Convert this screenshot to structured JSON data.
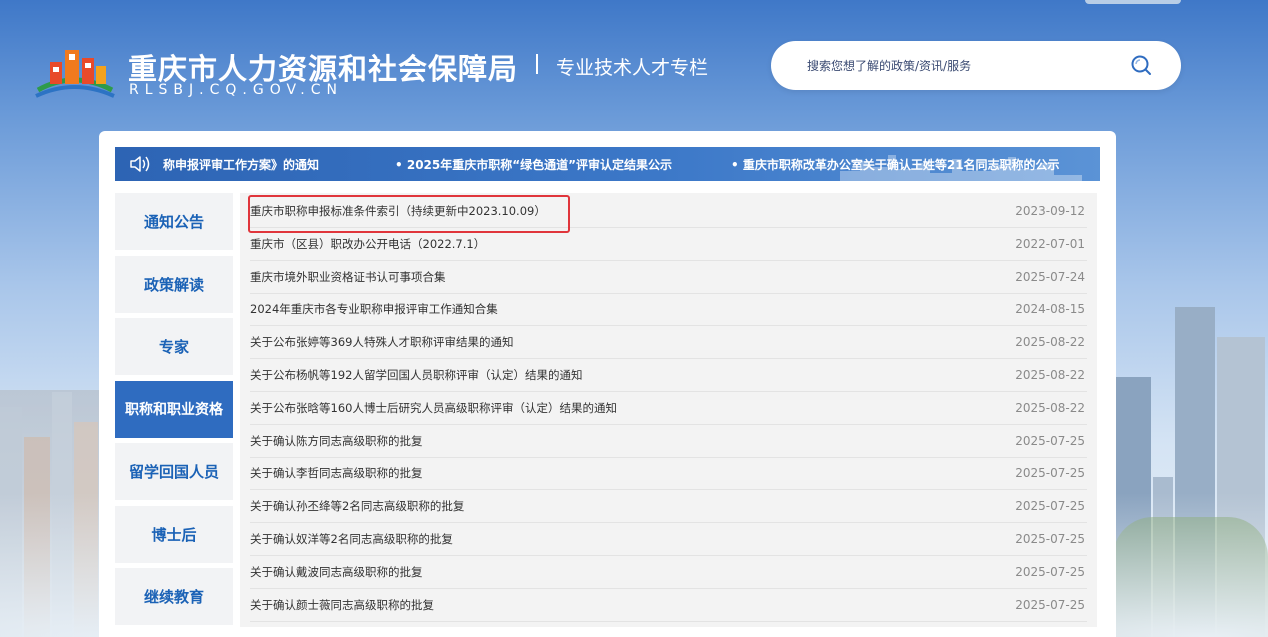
{
  "header": {
    "title": "重庆市人力资源和社会保障局",
    "domain": "RLSBJ.CQ.GOV.CN",
    "separator": "|",
    "column_name": "专业技术人才专栏"
  },
  "search": {
    "placeholder": "搜索您想了解的政策/资讯/服务",
    "icon": "search-icon"
  },
  "ticker": {
    "icon": "speaker-icon",
    "items": [
      "称申报评审工作方案》的通知",
      "• 2025年重庆市职称“绿色通道”评审认定结果公示",
      "• 重庆市职称改革办公室关于确认王姓等21名同志职称的公示"
    ]
  },
  "sidebar": {
    "items": [
      {
        "label": "通知公告"
      },
      {
        "label": "政策解读"
      },
      {
        "label": "专家"
      },
      {
        "label": "职称和职业资格"
      },
      {
        "label": "留学回国人员"
      },
      {
        "label": "博士后"
      },
      {
        "label": "继续教育"
      }
    ],
    "active_index": 3
  },
  "list": {
    "rows": [
      {
        "title": "重庆市职称申报标准条件索引（持续更新中2023.10.09）",
        "date": "2023-09-12"
      },
      {
        "title": "重庆市（区县）职改办公开电话（2022.7.1）",
        "date": "2022-07-01"
      },
      {
        "title": "重庆市境外职业资格证书认可事项合集",
        "date": "2025-07-24"
      },
      {
        "title": "2024年重庆市各专业职称申报评审工作通知合集",
        "date": "2024-08-15"
      },
      {
        "title": "关于公布张婷等369人特殊人才职称评审结果的通知",
        "date": "2025-08-22"
      },
      {
        "title": "关于公布杨帆等192人留学回国人员职称评审（认定）结果的通知",
        "date": "2025-08-22"
      },
      {
        "title": "关于公布张晗等160人博士后研究人员高级职称评审（认定）结果的通知",
        "date": "2025-08-22"
      },
      {
        "title": "关于确认陈方同志高级职称的批复",
        "date": "2025-07-25"
      },
      {
        "title": "关于确认李哲同志高级职称的批复",
        "date": "2025-07-25"
      },
      {
        "title": "关于确认孙丕绛等2名同志高级职称的批复",
        "date": "2025-07-25"
      },
      {
        "title": "关于确认奴洋等2名同志高级职称的批复",
        "date": "2025-07-25"
      },
      {
        "title": "关于确认戴波同志高级职称的批复",
        "date": "2025-07-25"
      },
      {
        "title": "关于确认颜士薇同志高级职称的批复",
        "date": "2025-07-25"
      }
    ]
  },
  "colors": {
    "brand_blue": "#2f6cc0",
    "sidebar_text": "#1b62b6",
    "highlight_red": "#e0353b"
  }
}
